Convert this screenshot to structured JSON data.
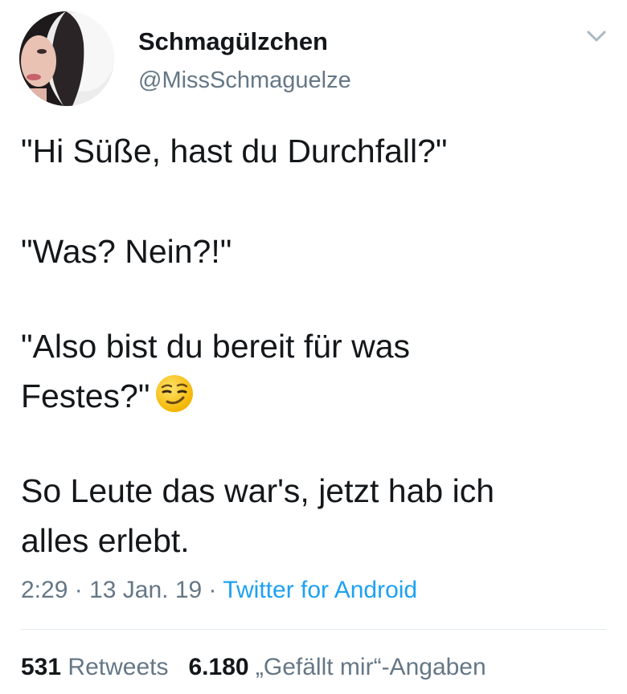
{
  "author": {
    "display_name": "Schmagülzchen",
    "handle": "@MissSchmaguelze"
  },
  "tweet": {
    "lines": [
      "\"Hi Süße, hast du Durchfall?\"",
      "\"Was? Nein?!\"",
      "\"Also bist du bereit für was",
      "Festes?\"",
      "So Leute das war's, jetzt hab ich",
      "alles erlebt."
    ],
    "emoji": "smirking-face"
  },
  "meta": {
    "time": "2:29",
    "separator": "·",
    "date": "13 Jan. 19",
    "source": "Twitter for Android"
  },
  "stats": {
    "retweets_count": "531",
    "retweets_label": "Retweets",
    "likes_count": "6.180",
    "likes_label": "„Gefällt mir“-Angaben"
  },
  "icons": {
    "menu": "chevron-down-icon",
    "avatar": "profile-picture"
  },
  "colors": {
    "text": "#14171a",
    "secondary": "#657786",
    "link": "#1da1f2",
    "divider": "#e1e8ed"
  }
}
